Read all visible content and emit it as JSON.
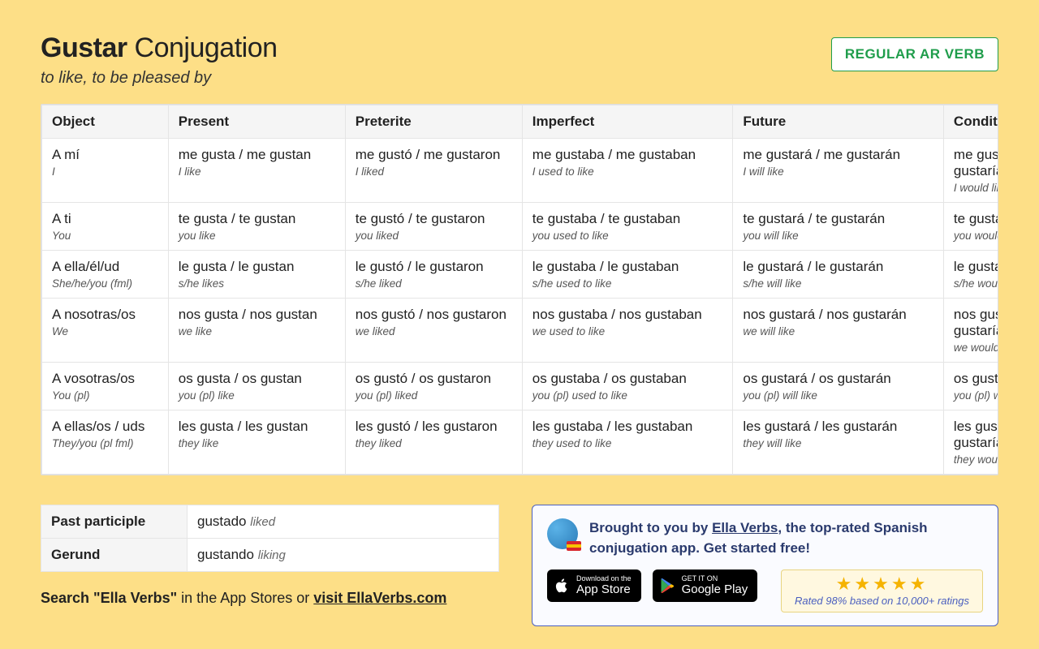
{
  "header": {
    "verb": "Gustar",
    "word": "Conjugation",
    "subtitle": "to like, to be pleased by",
    "badge": "REGULAR AR VERB"
  },
  "columns": [
    "Object",
    "Present",
    "Preterite",
    "Imperfect",
    "Future",
    "Conditional"
  ],
  "rows": [
    {
      "obj_es": "A mí",
      "obj_en": "I",
      "cells": [
        {
          "es": "me gusta / me gustan",
          "en": "I like"
        },
        {
          "es": "me gustó / me gustaron",
          "en": "I liked"
        },
        {
          "es": "me gustaba / me gustaban",
          "en": "I used to like"
        },
        {
          "es": "me gustará / me gustarán",
          "en": "I will like"
        },
        {
          "es": "me gustaría / me gustarían",
          "en": "I would like"
        }
      ]
    },
    {
      "obj_es": "A ti",
      "obj_en": "You",
      "cells": [
        {
          "es": "te gusta / te gustan",
          "en": "you like"
        },
        {
          "es": "te gustó / te gustaron",
          "en": "you liked"
        },
        {
          "es": "te gustaba / te gustaban",
          "en": "you used to like"
        },
        {
          "es": "te gustará / te gustarán",
          "en": "you will like"
        },
        {
          "es": "te gustaría / te gustarían",
          "en": "you would like"
        }
      ]
    },
    {
      "obj_es": "A ella/él/ud",
      "obj_en": "She/he/you (fml)",
      "cells": [
        {
          "es": "le gusta / le gustan",
          "en": "s/he likes"
        },
        {
          "es": "le gustó / le gustaron",
          "en": "s/he liked"
        },
        {
          "es": "le gustaba / le gustaban",
          "en": "s/he used to like"
        },
        {
          "es": "le gustará / le gustarán",
          "en": "s/he will like"
        },
        {
          "es": "le gustaría / le gustarían",
          "en": "s/he would like"
        }
      ]
    },
    {
      "obj_es": "A nosotras/os",
      "obj_en": "We",
      "cells": [
        {
          "es": "nos gusta / nos gustan",
          "en": "we like"
        },
        {
          "es": "nos gustó / nos gustaron",
          "en": "we liked"
        },
        {
          "es": "nos gustaba / nos gustaban",
          "en": "we used to like"
        },
        {
          "es": "nos gustará / nos gustarán",
          "en": "we will like"
        },
        {
          "es": "nos gustaría / nos gustarían",
          "en": "we would like"
        }
      ]
    },
    {
      "obj_es": "A vosotras/os",
      "obj_en": "You (pl)",
      "cells": [
        {
          "es": "os gusta / os gustan",
          "en": "you (pl) like"
        },
        {
          "es": "os gustó / os gustaron",
          "en": "you (pl) liked"
        },
        {
          "es": "os gustaba / os gustaban",
          "en": "you (pl) used to like"
        },
        {
          "es": "os gustará / os gustarán",
          "en": "you (pl) will like"
        },
        {
          "es": "os gustaría / os gustarían",
          "en": "you (pl) would like"
        }
      ]
    },
    {
      "obj_es": "A ellas/os / uds",
      "obj_en": "They/you (pl fml)",
      "cells": [
        {
          "es": "les gusta / les gustan",
          "en": "they like"
        },
        {
          "es": "les gustó / les gustaron",
          "en": "they liked"
        },
        {
          "es": "les gustaba / les gustaban",
          "en": "they used to like"
        },
        {
          "es": "les gustará / les gustarán",
          "en": "they will like"
        },
        {
          "es": "les gustaría / les gustarían",
          "en": "they would like"
        }
      ]
    }
  ],
  "participle": {
    "past_label": "Past participle",
    "past_es": "gustado",
    "past_en": "liked",
    "gerund_label": "Gerund",
    "gerund_es": "gustando",
    "gerund_en": "liking"
  },
  "search_line": {
    "bold": "Search \"Ella Verbs\"",
    "rest": " in the App Stores or ",
    "link": "visit EllaVerbs.com"
  },
  "promo": {
    "pre": "Brought to you by ",
    "link": "Ella Verbs",
    "post": ", the top-rated Spanish conjugation app. Get started free!",
    "app_store_small": "Download on the",
    "app_store_big": "App Store",
    "google_small": "GET IT ON",
    "google_big": "Google Play",
    "stars": "★★★★★",
    "rating_text": "Rated 98% based on 10,000+ ratings"
  }
}
